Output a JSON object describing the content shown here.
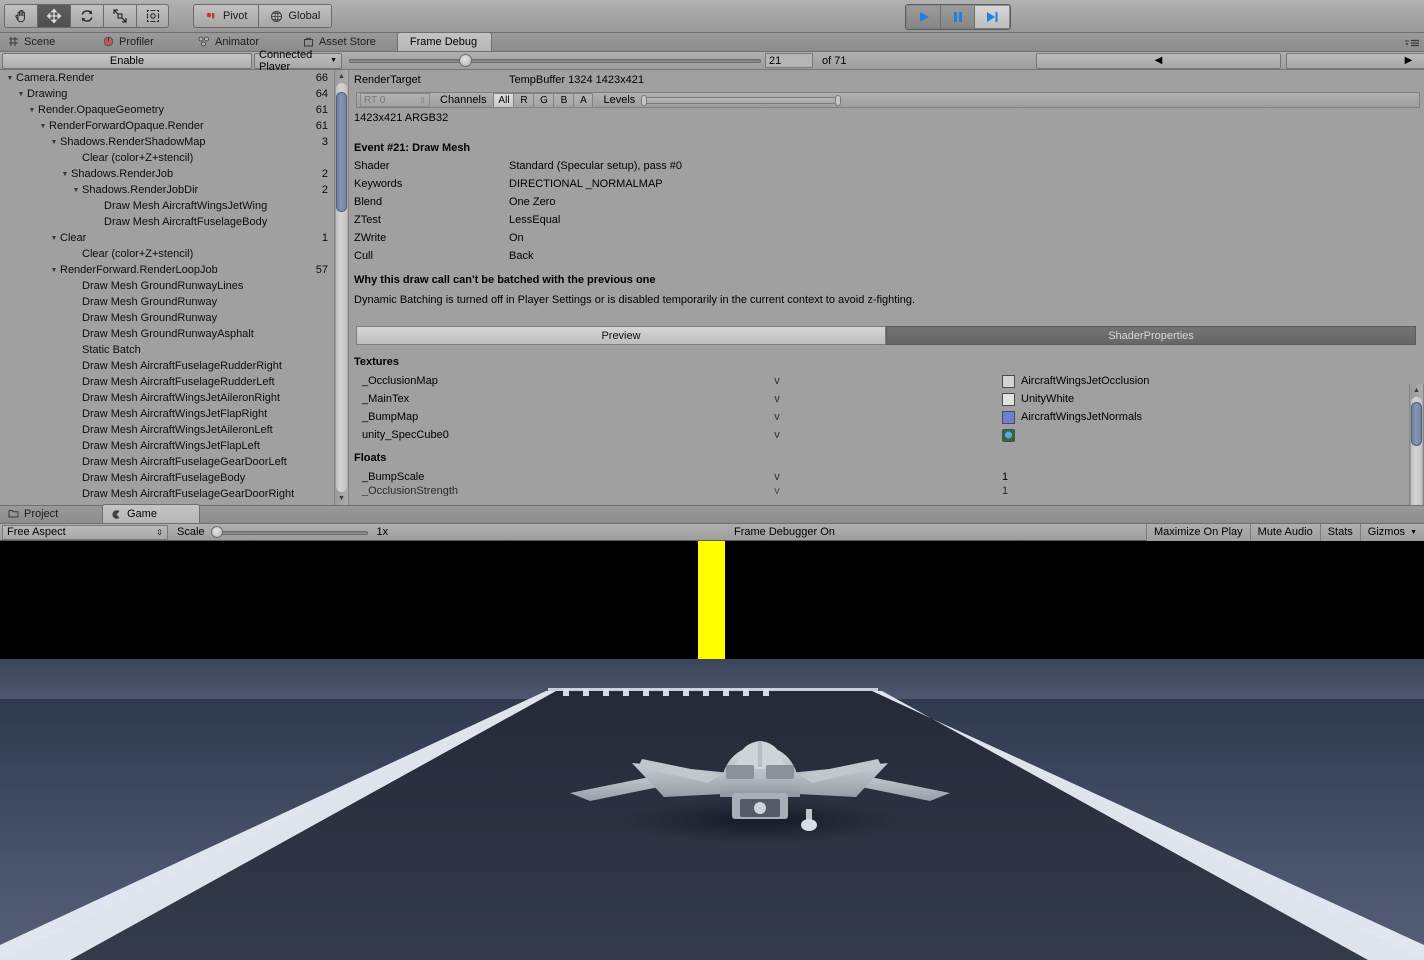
{
  "toolbar": {
    "tools": [
      {
        "name": "hand-tool",
        "icon": "hand",
        "active": false
      },
      {
        "name": "move-tool",
        "icon": "move",
        "active": true
      },
      {
        "name": "rotate-tool",
        "icon": "rotate",
        "active": false
      },
      {
        "name": "scale-tool",
        "icon": "scale",
        "active": false
      },
      {
        "name": "rect-tool",
        "icon": "rect",
        "active": false
      }
    ],
    "pivot_label": "Pivot",
    "global_label": "Global",
    "play_label": "play",
    "pause_label": "pause",
    "step_label": "step"
  },
  "window_tabs": [
    {
      "label": "Scene",
      "icon": "grid-icon",
      "active": false
    },
    {
      "label": "Profiler",
      "icon": "gauge-icon",
      "active": false
    },
    {
      "label": "Animator",
      "icon": "nodes-icon",
      "active": false
    },
    {
      "label": "Asset Store",
      "icon": "bag-icon",
      "active": false
    },
    {
      "label": "Frame Debug",
      "icon": "",
      "active": true
    }
  ],
  "frame_debugger": {
    "enable_label": "Enable",
    "connected_player_label": "Connected Player",
    "frame_number": "21",
    "frame_total_label": "of 71",
    "prev_label": "◀",
    "next_label": "▶",
    "tree": [
      {
        "label": "Camera.Render",
        "count": "66",
        "depth": 0,
        "expanded": true
      },
      {
        "label": "Drawing",
        "count": "64",
        "depth": 1,
        "expanded": true
      },
      {
        "label": "Render.OpaqueGeometry",
        "count": "61",
        "depth": 2,
        "expanded": true
      },
      {
        "label": "RenderForwardOpaque.Render",
        "count": "61",
        "depth": 3,
        "expanded": true
      },
      {
        "label": "Shadows.RenderShadowMap",
        "count": "3",
        "depth": 4,
        "expanded": true
      },
      {
        "label": "Clear (color+Z+stencil)",
        "count": "",
        "depth": 6,
        "expanded": null
      },
      {
        "label": "Shadows.RenderJob",
        "count": "2",
        "depth": 5,
        "expanded": true
      },
      {
        "label": "Shadows.RenderJobDir",
        "count": "2",
        "depth": 6,
        "expanded": true
      },
      {
        "label": "Draw Mesh AircraftWingsJetWing",
        "count": "",
        "depth": 8,
        "expanded": null
      },
      {
        "label": "Draw Mesh AircraftFuselageBody",
        "count": "",
        "depth": 8,
        "expanded": null
      },
      {
        "label": "Clear",
        "count": "1",
        "depth": 4,
        "expanded": true
      },
      {
        "label": "Clear (color+Z+stencil)",
        "count": "",
        "depth": 6,
        "expanded": null
      },
      {
        "label": "RenderForward.RenderLoopJob",
        "count": "57",
        "depth": 4,
        "expanded": true
      },
      {
        "label": "Draw Mesh GroundRunwayLines",
        "count": "",
        "depth": 6,
        "expanded": null
      },
      {
        "label": "Draw Mesh GroundRunway",
        "count": "",
        "depth": 6,
        "expanded": null
      },
      {
        "label": "Draw Mesh GroundRunway",
        "count": "",
        "depth": 6,
        "expanded": null
      },
      {
        "label": "Draw Mesh GroundRunwayAsphalt",
        "count": "",
        "depth": 6,
        "expanded": null
      },
      {
        "label": "Static Batch",
        "count": "",
        "depth": 6,
        "expanded": null
      },
      {
        "label": "Draw Mesh AircraftFuselageRudderRight",
        "count": "",
        "depth": 6,
        "expanded": null
      },
      {
        "label": "Draw Mesh AircraftFuselageRudderLeft",
        "count": "",
        "depth": 6,
        "expanded": null
      },
      {
        "label": "Draw Mesh AircraftWingsJetAileronRight",
        "count": "",
        "depth": 6,
        "expanded": null
      },
      {
        "label": "Draw Mesh AircraftWingsJetFlapRight",
        "count": "",
        "depth": 6,
        "expanded": null
      },
      {
        "label": "Draw Mesh AircraftWingsJetAileronLeft",
        "count": "",
        "depth": 6,
        "expanded": null
      },
      {
        "label": "Draw Mesh AircraftWingsJetFlapLeft",
        "count": "",
        "depth": 6,
        "expanded": null
      },
      {
        "label": "Draw Mesh AircraftFuselageGearDoorLeft",
        "count": "",
        "depth": 6,
        "expanded": null
      },
      {
        "label": "Draw Mesh AircraftFuselageBody",
        "count": "",
        "depth": 6,
        "expanded": null
      },
      {
        "label": "Draw Mesh AircraftFuselageGearDoorRight",
        "count": "",
        "depth": 6,
        "expanded": null
      }
    ],
    "detail": {
      "render_target_key": "RenderTarget",
      "render_target_value": "TempBuffer 1324 1423x421",
      "rt_select_label": "RT 0",
      "channels_label": "Channels",
      "channel_buttons": [
        "All",
        "R",
        "G",
        "B",
        "A"
      ],
      "channel_active": "All",
      "levels_label": "Levels",
      "format_line": "1423x421 ARGB32",
      "event_title": "Event #21: Draw Mesh",
      "rows": [
        {
          "key": "Shader",
          "value": "Standard (Specular setup), pass #0"
        },
        {
          "key": "Keywords",
          "value": "DIRECTIONAL _NORMALMAP"
        },
        {
          "key": "Blend",
          "value": "One Zero"
        },
        {
          "key": "ZTest",
          "value": "LessEqual"
        },
        {
          "key": "ZWrite",
          "value": "On"
        },
        {
          "key": "Cull",
          "value": "Back"
        }
      ],
      "why_title": "Why this draw call can't be batched with the previous one",
      "why_body": "Dynamic Batching is turned off in Player Settings or is disabled temporarily in the current context to avoid z-fighting.",
      "preview_tab_label": "Preview",
      "shader_props_tab_label": "ShaderProperties",
      "textures_heading": "Textures",
      "textures": [
        {
          "name": "_OcclusionMap",
          "col": "v",
          "value": "AircraftWingsJetOcclusion",
          "swatch": "#cfd4d8"
        },
        {
          "name": "_MainTex",
          "col": "v",
          "value": "UnityWhite",
          "swatch": "#e2e2e2"
        },
        {
          "name": "_BumpMap",
          "col": "v",
          "value": "AircraftWingsJetNormals",
          "swatch": "#6f7fd8"
        },
        {
          "name": "unity_SpecCube0",
          "col": "v",
          "value": "",
          "swatch": "#2f6a3f"
        }
      ],
      "floats_heading": "Floats",
      "floats": [
        {
          "name": "_BumpScale",
          "col": "v",
          "value": "1"
        },
        {
          "name": "_OcclusionStrength",
          "col": "v",
          "value": "1"
        }
      ]
    }
  },
  "bottom_tabs": [
    {
      "label": "Project",
      "icon": "folder-icon",
      "active": false
    },
    {
      "label": "Game",
      "icon": "gamepad-icon",
      "active": true
    }
  ],
  "game_toolbar": {
    "aspect_label": "Free Aspect",
    "scale_label": "Scale",
    "scale_value": "1x",
    "frame_debugger_status": "Frame Debugger On",
    "maximize_label": "Maximize On Play",
    "mute_label": "Mute Audio",
    "stats_label": "Stats",
    "gizmos_label": "Gizmos"
  },
  "colors": {
    "panel_bg": "#a0a0a0",
    "accent_blue": "#2196f3",
    "yellow_bar": "#ffff00",
    "scrollbar_thumb": "#7a8ba8"
  }
}
